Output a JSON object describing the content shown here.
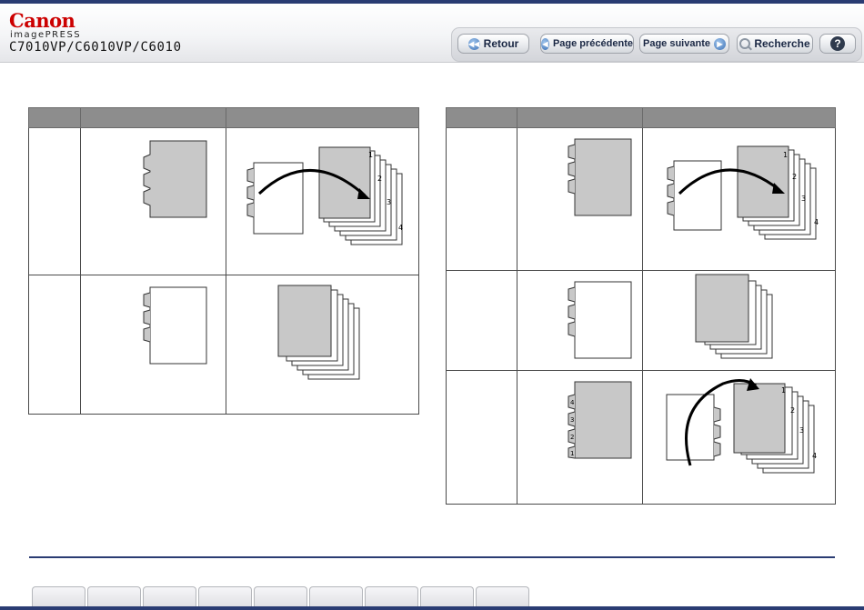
{
  "brand": {
    "logo": "Canon",
    "product": "imagePRESS",
    "models": "C7010VP/C6010VP/C6010"
  },
  "toolbar": {
    "back": "Retour",
    "prev": "Page précédente",
    "next": "Page suivante",
    "search": "Recherche",
    "help": "?"
  },
  "icons": {
    "back": "rewind-icon",
    "prev": "left-arrow-icon",
    "next": "right-arrow-icon",
    "search": "magnifier-icon",
    "help": "question-icon"
  },
  "figure_left": {
    "rows": [
      {
        "tab_labels": [
          "",
          "",
          ""
        ],
        "result_tab_labels": [
          "1",
          "2",
          "3",
          "4"
        ]
      },
      {
        "tab_labels": [
          "",
          "",
          ""
        ],
        "result_tab_labels": []
      }
    ]
  },
  "figure_right": {
    "rows": [
      {
        "tab_labels": [
          "",
          "",
          ""
        ],
        "result_tab_labels": [
          "1",
          "2",
          "3",
          "4"
        ]
      },
      {
        "tab_labels": [
          "",
          "",
          ""
        ],
        "result_tab_labels": []
      },
      {
        "tab_labels": [
          "4",
          "3",
          "2",
          "1"
        ],
        "result_tab_labels": [
          "1",
          "2",
          "3",
          "4"
        ]
      }
    ]
  },
  "colors": {
    "accent": "#2a3c73",
    "brand_red": "#cc0000",
    "header_cell": "#8d8d8d",
    "paper_gray": "#c8c8c8"
  }
}
